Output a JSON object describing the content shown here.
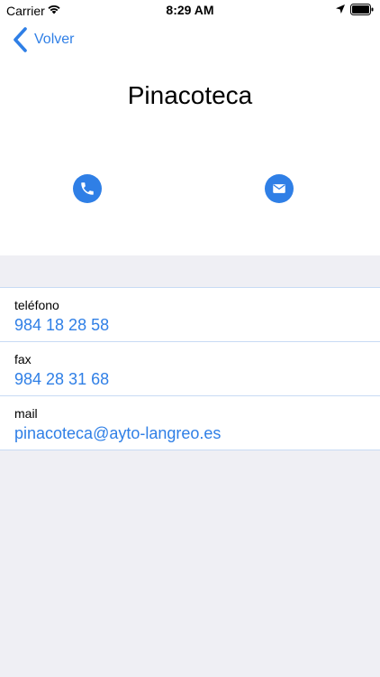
{
  "status_bar": {
    "carrier": "Carrier",
    "time": "8:29 AM"
  },
  "nav": {
    "back_label": "Volver"
  },
  "page": {
    "title": "Pinacoteca"
  },
  "actions": {
    "call_icon": "phone-icon",
    "mail_icon": "envelope-icon",
    "accent_color": "#2f7fe6"
  },
  "contacts": [
    {
      "label": "teléfono",
      "value": "984 18 28 58"
    },
    {
      "label": "fax",
      "value": "984 28 31 68"
    },
    {
      "label": "mail",
      "value": "pinacoteca@ayto-langreo.es"
    }
  ]
}
